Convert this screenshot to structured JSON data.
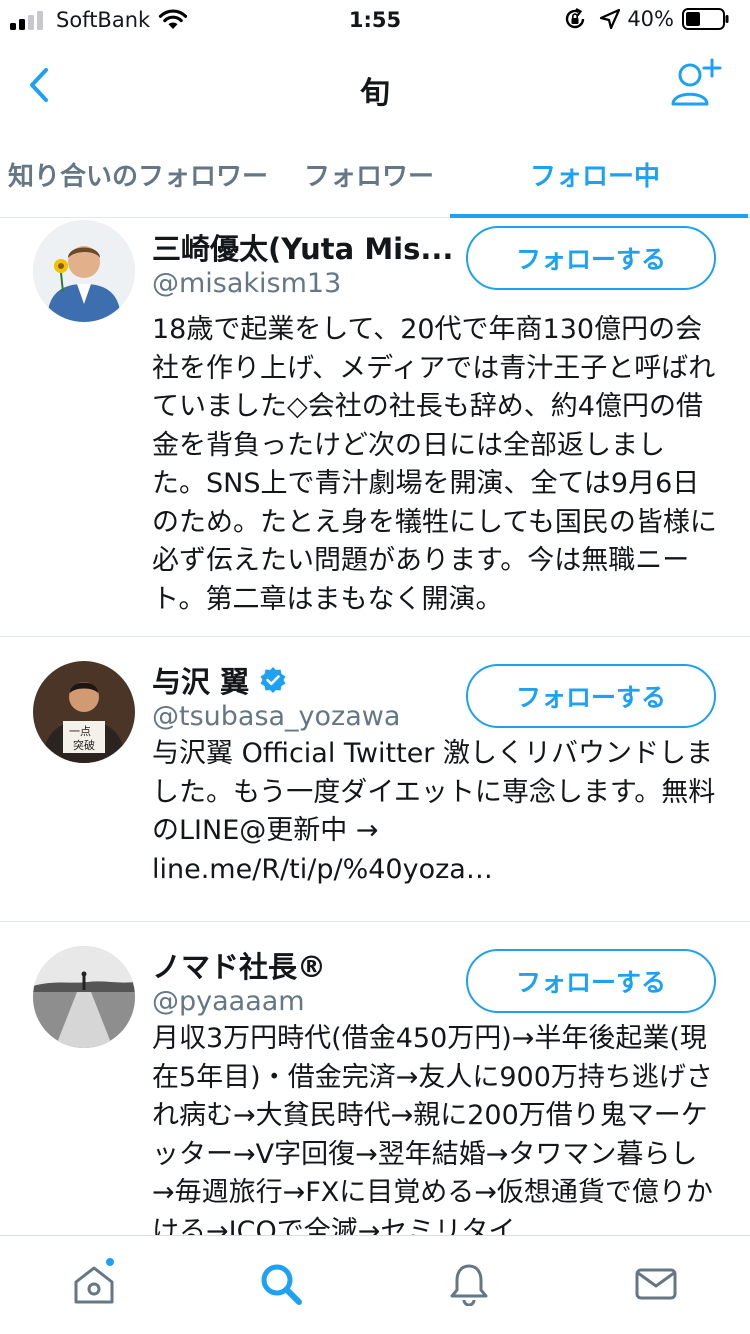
{
  "status_bar": {
    "carrier": "SoftBank",
    "time": "1:55",
    "battery_percent": "40%",
    "battery_level": 0.4,
    "icons": [
      "signal-bars-icon",
      "wifi-icon",
      "orientation-lock-icon",
      "location-arrow-icon",
      "battery-icon"
    ]
  },
  "nav": {
    "title": "旬",
    "back_icon": "chevron-left-icon",
    "add_user_icon": "add-user-icon"
  },
  "tabs": [
    {
      "label": "知り合いのフォロワー",
      "active": false
    },
    {
      "label": "フォロワー",
      "active": false
    },
    {
      "label": "フォロー中",
      "active": true
    }
  ],
  "users": [
    {
      "name": "三崎優太(Yuta Mis...",
      "handle": "@misakism13",
      "verified": false,
      "follow_label": "フォローする",
      "bio": "18歳で起業をして、20代で年商130億円の会社を作り上げ、メディアでは青汁王子と呼ばれていました◇会社の社長も辞め、約4億円の借金を背負ったけど次の日には全部返しました。SNS上で青汁劇場を開演、全ては9月6日のため。たとえ身を犠牲にしても国民の皆様に必ず伝えたい問題があります。今は無職ニート。第二章はまもなく開演。"
    },
    {
      "name": "与沢 翼",
      "handle": "@tsubasa_yozawa",
      "verified": true,
      "follow_label": "フォローする",
      "bio": "与沢翼 Official Twitter 激しくリバウンドしました。もう一度ダイエットに専念します。無料のLINE@更新中 → line.me/R/ti/p/%40yoza…"
    },
    {
      "name": "ノマド社長®",
      "handle": "@pyaaaam",
      "verified": false,
      "follow_label": "フォローする",
      "bio": "月収3万円時代(借金450万円)→半年後起業(現在5年目)・借金完済→友人に900万持ち逃げされ病む→大貧民時代→親に200万借り鬼マーケッター→V字回復→翌年結婚→タワマン暮らし→毎週旅行→FXに目覚める→仮想通貨で億りかける→ICOで全滅→セミリタイ"
    }
  ],
  "tab_bar": {
    "items": [
      "home-icon",
      "search-icon",
      "notifications-bell-icon",
      "messages-envelope-icon"
    ],
    "active": "search-icon",
    "home_has_badge": true
  },
  "colors": {
    "accent": "#1da1f2",
    "secondary_text": "#657786",
    "divider": "#e1e8ed"
  }
}
